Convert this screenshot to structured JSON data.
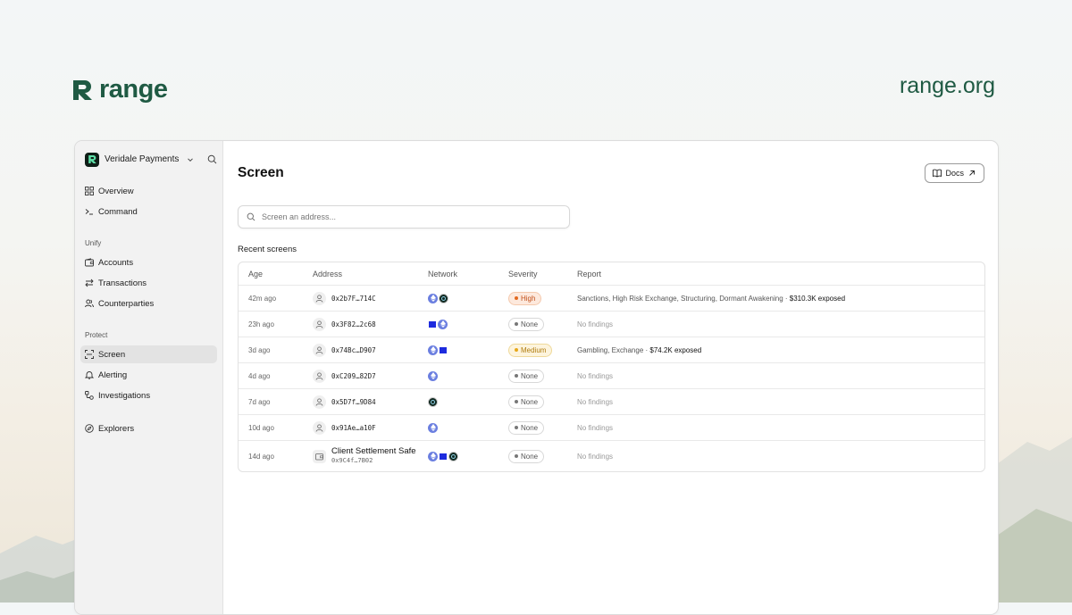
{
  "brand": {
    "name": "range",
    "site": "range.org",
    "color": "#1f5a43"
  },
  "sidebar": {
    "org_name": "Veridale Payments",
    "top_items": [
      {
        "label": "Overview",
        "icon": "grid-icon"
      },
      {
        "label": "Command",
        "icon": "terminal-icon"
      }
    ],
    "sections": [
      {
        "title": "Unify",
        "items": [
          {
            "label": "Accounts",
            "icon": "wallet-icon"
          },
          {
            "label": "Transactions",
            "icon": "arrows-icon"
          },
          {
            "label": "Counterparties",
            "icon": "users-icon"
          }
        ]
      },
      {
        "title": "Protect",
        "items": [
          {
            "label": "Screen",
            "icon": "scan-icon",
            "active": true
          },
          {
            "label": "Alerting",
            "icon": "bell-icon"
          },
          {
            "label": "Investigations",
            "icon": "nodes-icon"
          }
        ]
      }
    ],
    "bottom_items": [
      {
        "label": "Explorers",
        "icon": "compass-icon"
      }
    ]
  },
  "main": {
    "title": "Screen",
    "docs_label": "Docs",
    "search_placeholder": "Screen an address...",
    "recent_title": "Recent screens",
    "columns": [
      "Age",
      "Address",
      "Network",
      "Severity",
      "Report"
    ],
    "rows": [
      {
        "age": "42m ago",
        "address": "0x2b7F…714C",
        "networks": [
          "eth",
          "dark"
        ],
        "severity": "High",
        "severity_level": "high",
        "report": "Sanctions, High Risk Exchange, Structuring, Dormant Awakening",
        "exposed": "$310.3K exposed"
      },
      {
        "age": "23h ago",
        "address": "0x3F82…2c68",
        "networks": [
          "square",
          "eth"
        ],
        "severity": "None",
        "severity_level": "none",
        "report": "No findings",
        "exposed": ""
      },
      {
        "age": "3d ago",
        "address": "0x74Bc…D907",
        "networks": [
          "eth",
          "square"
        ],
        "severity": "Medium",
        "severity_level": "medium",
        "report": "Gambling, Exchange",
        "exposed": "$74.2K exposed"
      },
      {
        "age": "4d ago",
        "address": "0xC209…82D7",
        "networks": [
          "eth"
        ],
        "severity": "None",
        "severity_level": "none",
        "report": "No findings",
        "exposed": ""
      },
      {
        "age": "7d ago",
        "address": "0x5D7f…9D84",
        "networks": [
          "dark"
        ],
        "severity": "None",
        "severity_level": "none",
        "report": "No findings",
        "exposed": ""
      },
      {
        "age": "10d ago",
        "address": "0x91Ae…a10F",
        "networks": [
          "eth"
        ],
        "severity": "None",
        "severity_level": "none",
        "report": "No findings",
        "exposed": ""
      },
      {
        "age": "14d ago",
        "address_name": "Client Settlement Safe",
        "address": "0x9C4f…7B02",
        "networks": [
          "eth",
          "square",
          "dark"
        ],
        "severity": "None",
        "severity_level": "none",
        "report": "No findings",
        "exposed": ""
      }
    ]
  }
}
